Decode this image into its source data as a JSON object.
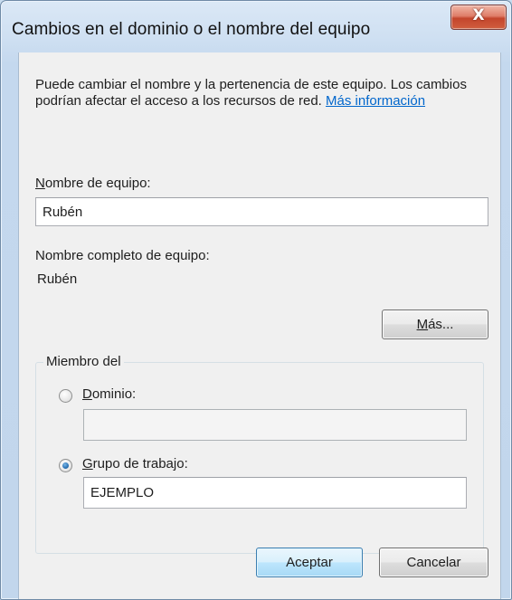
{
  "window": {
    "title": "Cambios en el dominio o el nombre del equipo",
    "close_glyph": "X"
  },
  "info": {
    "text": "Puede cambiar el nombre y la pertenencia de este equipo. Los cambios podrían afectar el acceso a los recursos de red.",
    "link": "Más información"
  },
  "computer_name": {
    "label_accel": "N",
    "label_rest": "ombre de equipo:",
    "value": "Rubén"
  },
  "full_name": {
    "label": "Nombre completo de equipo:",
    "value": "Rubén"
  },
  "more_button": {
    "accel": "M",
    "rest": "ás..."
  },
  "member_of": {
    "legend": "Miembro del",
    "domain": {
      "accel": "D",
      "rest": "ominio:",
      "value": "",
      "selected": false
    },
    "workgroup": {
      "accel": "G",
      "rest": "rupo de trabajo:",
      "value": "EJEMPLO",
      "selected": true
    }
  },
  "buttons": {
    "ok": "Aceptar",
    "cancel": "Cancelar"
  }
}
